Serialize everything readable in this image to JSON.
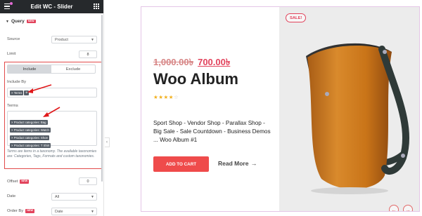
{
  "sidebar": {
    "title": "Edit WC - Slider",
    "section": {
      "title": "Query",
      "badge": "NEW"
    },
    "source": {
      "label": "Source",
      "value": "Product"
    },
    "limit": {
      "label": "Limit",
      "value": "8"
    },
    "tabs": [
      {
        "label": "Include",
        "active": true
      },
      {
        "label": "Exclude",
        "active": false
      }
    ],
    "include_by": {
      "label": "Include By",
      "chip": "Terms",
      "add": "+"
    },
    "terms": {
      "label": "Terms",
      "chips": [
        "Product categories: Bag",
        "Product categories: Watch",
        "Product categories: Shoe",
        "Product categories: T Shirt"
      ]
    },
    "help_text": "Terms are items in a taxonomy. The available taxonomies are: Categories, Tags, Formats and custom taxonomies.",
    "offset": {
      "label": "Offset",
      "badge": "NEW",
      "value": "0"
    },
    "date": {
      "label": "Date",
      "value": "All"
    },
    "order_by": {
      "label": "Order By",
      "badge": "NEW",
      "value": "Date"
    }
  },
  "slide": {
    "badge": "SALE!",
    "old_price": "1,000.00৳",
    "new_price": "700.00৳",
    "title": "Woo Album",
    "rating": 4,
    "rating_max": 5,
    "description": "Sport Shop - Vendor Shop - Parallax Shop - Big Sale - Sale Countdown - Business Demos ... Woo Album #1",
    "cart_label": "ADD TO CART",
    "more_label": "Read More",
    "prev_icon": "←",
    "next_icon": "→"
  },
  "colors": {
    "accent": "#e2435c",
    "header_bg": "#26292c",
    "highlight": "#e24a4a",
    "cart_button": "#ef4b4b"
  }
}
